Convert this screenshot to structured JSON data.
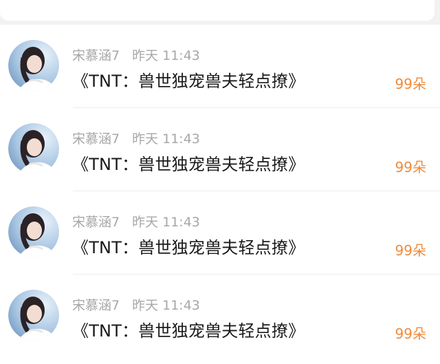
{
  "header": {
    "icon": "search-icon"
  },
  "messages": [
    {
      "name": "宋慕涵7",
      "time": "昨天 11:43",
      "title": "《TNT：兽世独宠兽夫轻点撩》",
      "count": "99朵"
    },
    {
      "name": "宋慕涵7",
      "time": "昨天 11:43",
      "title": "《TNT：兽世独宠兽夫轻点撩》",
      "count": "99朵"
    },
    {
      "name": "宋慕涵7",
      "time": "昨天 11:43",
      "title": "《TNT：兽世独宠兽夫轻点撩》",
      "count": "99朵"
    },
    {
      "name": "宋慕涵7",
      "time": "昨天 11:43",
      "title": "《TNT：兽世独宠兽夫轻点撩》",
      "count": "99朵"
    }
  ],
  "colors": {
    "accent": "#ef8a3a",
    "meta": "#a7a7a7",
    "title": "#1a1a1a",
    "icon": "#4a90e2"
  }
}
